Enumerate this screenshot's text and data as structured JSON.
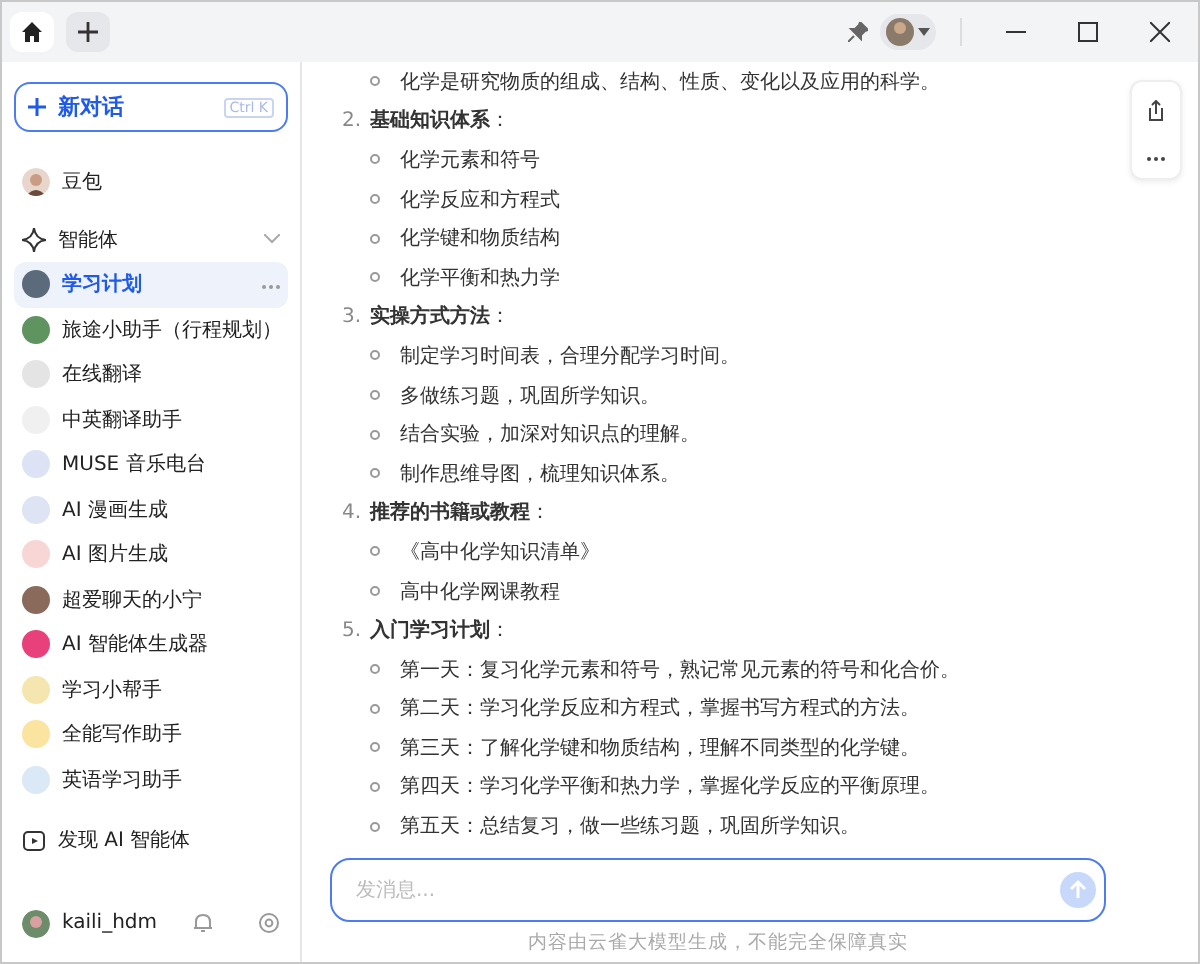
{
  "tabs": [
    {
      "kind": "home",
      "selected": true
    },
    {
      "kind": "new",
      "selected": false
    }
  ],
  "sidebar": {
    "new_chat": {
      "label": "新对话",
      "shortcut": "Ctrl K"
    },
    "profile": {
      "name": "豆包"
    },
    "section": {
      "label": "智能体",
      "expanded": true
    },
    "agents": [
      {
        "name": "学习计划",
        "selected": true,
        "color": "#5b6b7c"
      },
      {
        "name": "旅途小助手（行程规划）",
        "selected": false,
        "color": "#5f9460"
      },
      {
        "name": "在线翻译",
        "selected": false,
        "color": "#e4e4e4"
      },
      {
        "name": "中英翻译助手",
        "selected": false,
        "color": "#f0f0f0"
      },
      {
        "name": "MUSE 音乐电台",
        "selected": false,
        "color": "#dde3f5"
      },
      {
        "name": "AI 漫画生成",
        "selected": false,
        "color": "#dfe4f5"
      },
      {
        "name": "AI 图片生成",
        "selected": false,
        "color": "#f8d6d6"
      },
      {
        "name": "超爱聊天的小宁",
        "selected": false,
        "color": "#8a6a5a"
      },
      {
        "name": "AI 智能体生成器",
        "selected": false,
        "color": "#e8407a"
      },
      {
        "name": "学习小帮手",
        "selected": false,
        "color": "#f5e6b0"
      },
      {
        "name": "全能写作助手",
        "selected": false,
        "color": "#fbe3a0"
      },
      {
        "name": "英语学习助手",
        "selected": false,
        "color": "#dbe8f5"
      }
    ],
    "discover": {
      "label": "发现 AI 智能体"
    },
    "user": {
      "name": "kaili_hdm"
    }
  },
  "content": {
    "lead_items": [
      "化学是研究物质的组成、结构、性质、变化以及应用的科学。"
    ],
    "sections": [
      {
        "number": "2.",
        "title": "**基础知识体系**：",
        "items": [
          "化学元素和符号",
          "化学反应和方程式",
          "化学键和物质结构",
          "化学平衡和热力学"
        ]
      },
      {
        "number": "3.",
        "title": "**实操方式方法**：",
        "items": [
          "制定学习时间表，合理分配学习时间。",
          "多做练习题，巩固所学知识。",
          "结合实验，加深对知识点的理解。",
          "制作思维导图，梳理知识体系。"
        ]
      },
      {
        "number": "4.",
        "title": "**推荐的书籍或教程**：",
        "items": [
          "《高中化学知识清单》",
          "高中化学网课教程"
        ]
      },
      {
        "number": "5.",
        "title": "**入门学习计划**：",
        "items": [
          "第一天：复习化学元素和符号，熟记常见元素的符号和化合价。",
          "第二天：学习化学反应和方程式，掌握书写方程式的方法。",
          "第三天：了解化学键和物质结构，理解不同类型的化学键。",
          "第四天：学习化学平衡和热力学，掌握化学反应的平衡原理。",
          "第五天：总结复习，做一些练习题，巩固所学知识。"
        ]
      }
    ]
  },
  "composer": {
    "placeholder": "发消息..."
  },
  "disclaimer": "内容由云雀大模型生成，不能完全保障真实"
}
